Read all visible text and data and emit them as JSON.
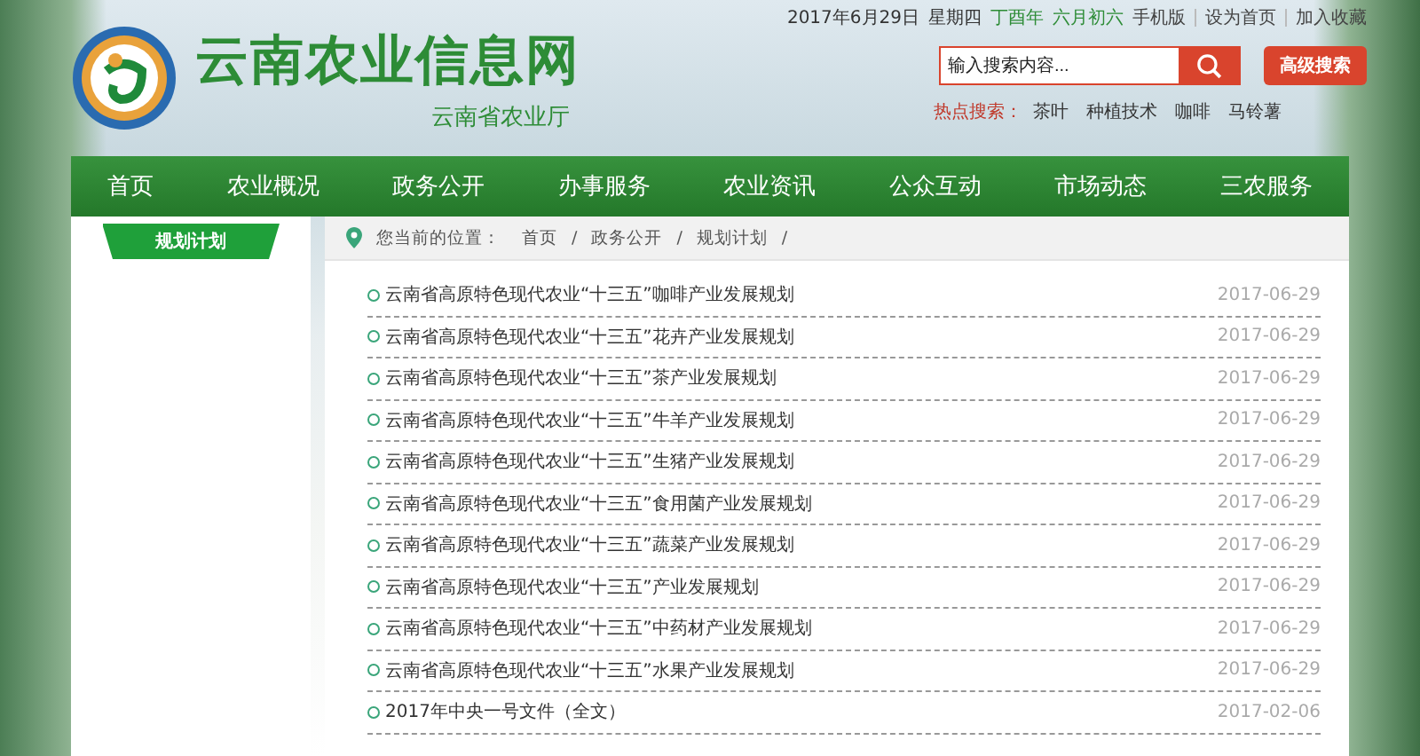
{
  "header": {
    "site_title": "云南农业信息网",
    "subtitle": "云南省农业厅",
    "date": "2017年6月29日",
    "weekday": "星期四",
    "lunar_year": "丁酉年",
    "lunar_date": "六月初六",
    "top_links": [
      "手机版",
      "设为首页",
      "加入收藏"
    ],
    "search": {
      "placeholder": "输入搜索内容...",
      "advanced_button": "高级搜索"
    },
    "hot_search": {
      "label": "热点搜索：",
      "terms": [
        "茶叶",
        "种植技术",
        "咖啡",
        "马铃薯"
      ]
    }
  },
  "nav": [
    "首页",
    "农业概况",
    "政务公开",
    "办事服务",
    "农业资讯",
    "公众互动",
    "市场动态",
    "三农服务"
  ],
  "sidebar": {
    "items": [
      {
        "label": "规划计划",
        "selected": true
      }
    ]
  },
  "breadcrumb": {
    "label": "您当前的位置：",
    "items": [
      "首页",
      "政务公开",
      "规划计划"
    ],
    "separator": "/"
  },
  "articles": [
    {
      "title": "云南省高原特色现代农业“十三五”咖啡产业发展规划",
      "date": "2017-06-29"
    },
    {
      "title": "云南省高原特色现代农业“十三五”花卉产业发展规划",
      "date": "2017-06-29"
    },
    {
      "title": "云南省高原特色现代农业“十三五”茶产业发展规划",
      "date": "2017-06-29"
    },
    {
      "title": "云南省高原特色现代农业“十三五”牛羊产业发展规划",
      "date": "2017-06-29"
    },
    {
      "title": "云南省高原特色现代农业“十三五”生猪产业发展规划",
      "date": "2017-06-29"
    },
    {
      "title": "云南省高原特色现代农业“十三五”食用菌产业发展规划",
      "date": "2017-06-29"
    },
    {
      "title": "云南省高原特色现代农业“十三五”蔬菜产业发展规划",
      "date": "2017-06-29"
    },
    {
      "title": "云南省高原特色现代农业“十三五”产业发展规划",
      "date": "2017-06-29"
    },
    {
      "title": "云南省高原特色现代农业“十三五”中药材产业发展规划",
      "date": "2017-06-29"
    },
    {
      "title": "云南省高原特色现代农业“十三五”水果产业发展规划",
      "date": "2017-06-29"
    },
    {
      "title": "2017年中央一号文件（全文）",
      "date": "2017-02-06"
    }
  ]
}
